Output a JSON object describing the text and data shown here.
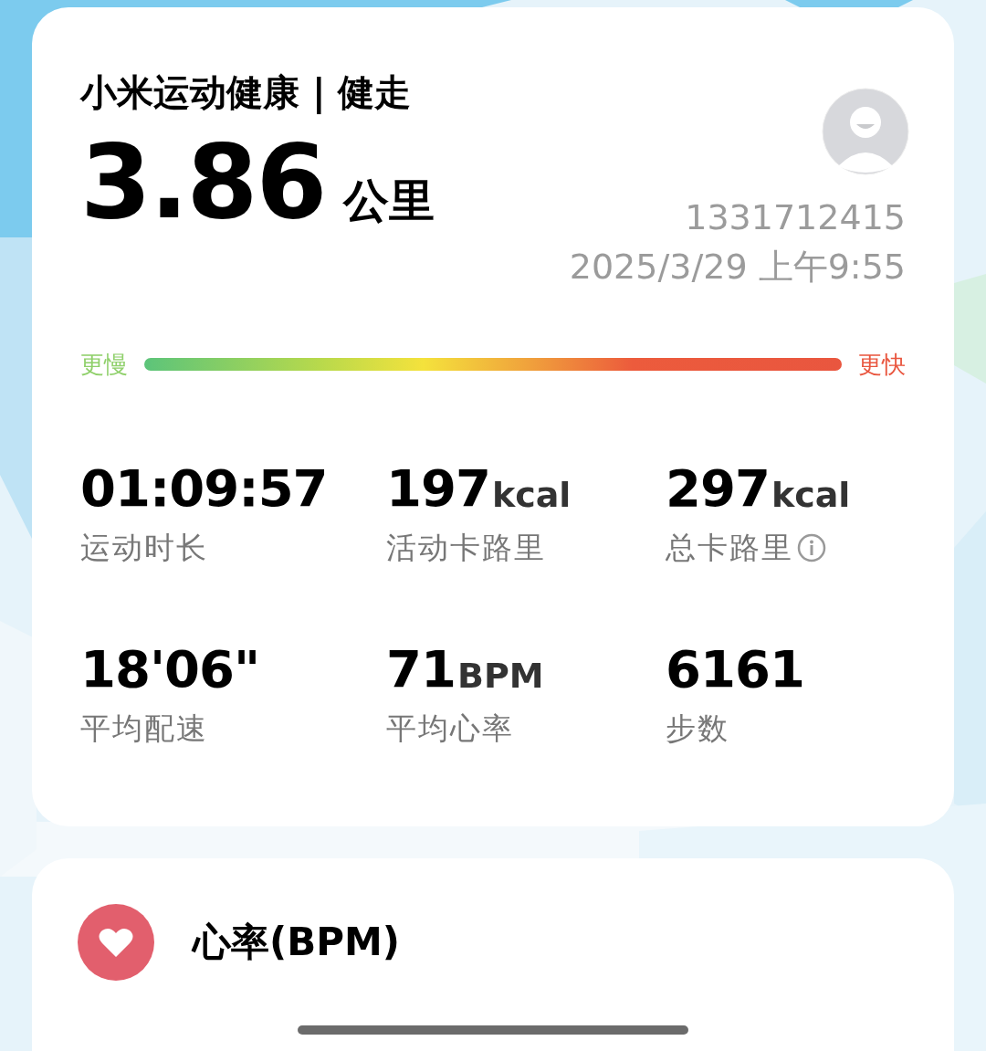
{
  "app_title": "小米运动健康 | 健走",
  "distance": {
    "value": "3.86",
    "unit": "公里"
  },
  "user": {
    "id": "1331712415",
    "datetime": "2025/3/29 上午9:55"
  },
  "pace_scale": {
    "slow_label": "更慢",
    "fast_label": "更快"
  },
  "stats": [
    {
      "value": "01:09:57",
      "label": "运动时长",
      "info": false
    },
    {
      "value": "197",
      "unit": "kcal",
      "label": "活动卡路里",
      "info": false
    },
    {
      "value": "297",
      "unit": "kcal",
      "label": "总卡路里",
      "info": true
    },
    {
      "value": "18'06\"",
      "label": "平均配速",
      "info": false
    },
    {
      "value": "71",
      "unit": "BPM",
      "label": "平均心率",
      "info": false
    },
    {
      "value": "6161",
      "label": "步数",
      "info": false
    }
  ],
  "heart_rate_section": {
    "title": "心率(BPM)"
  }
}
